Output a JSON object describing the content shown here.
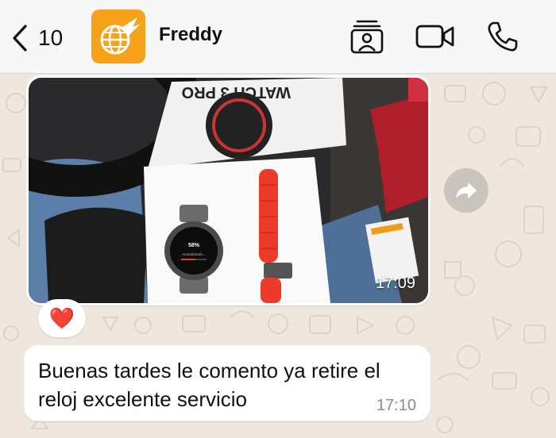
{
  "header": {
    "back_count": "10",
    "contact_name": "Freddy",
    "icons": [
      "chevron-left-icon",
      "contact-card-icon",
      "video-camera-icon",
      "phone-icon"
    ]
  },
  "messages": [
    {
      "type": "image",
      "time": "17:09",
      "reaction": "❤️",
      "photo_text": {
        "box_label": "WATCH 3 PRO",
        "watch_percent": "58%",
        "watch_status": "Actualizando..."
      }
    },
    {
      "type": "text",
      "text": "Buenas tardes le comento ya retire el reloj excelente servicio",
      "time": "17:10"
    }
  ],
  "colors": {
    "wallpaper": "#efe7de",
    "header_bg": "#f7f7f7",
    "avatar_bg": "#f7a21b",
    "strap_red": "#ec3b2a",
    "heart": "#e0243a"
  }
}
